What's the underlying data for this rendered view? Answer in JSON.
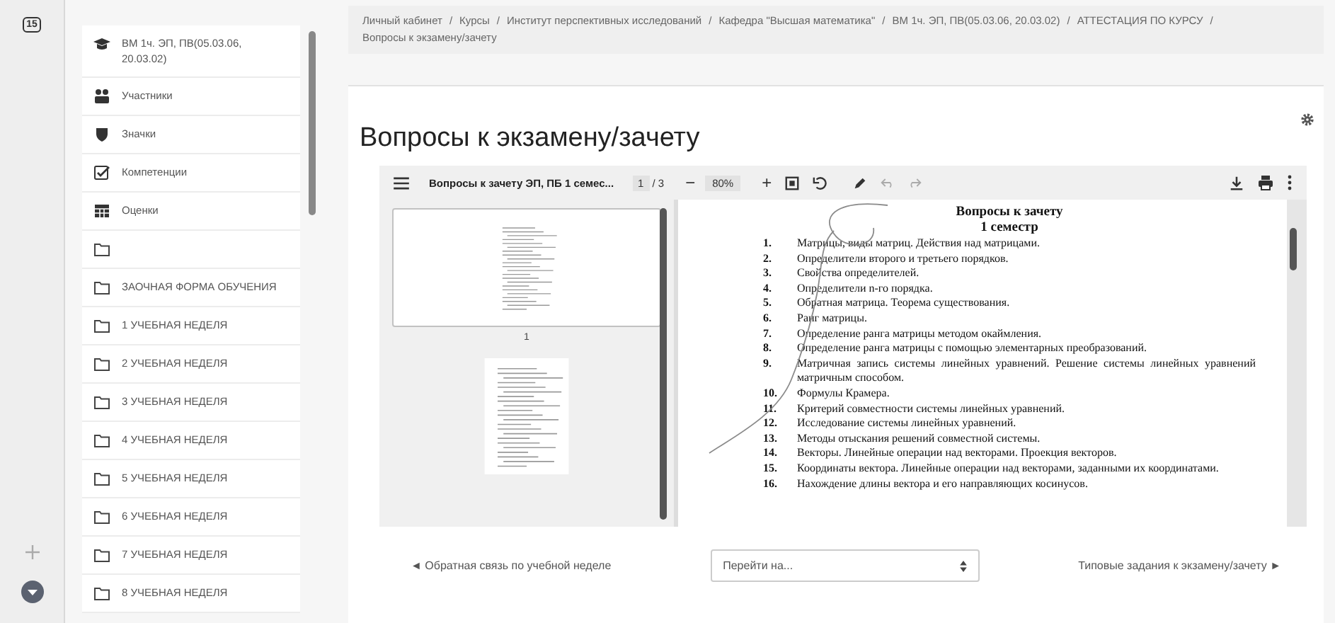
{
  "left_rail": {
    "calendar_badge": "15"
  },
  "nav": {
    "items": [
      {
        "kind": "cap",
        "label": "ВМ 1ч. ЭП, ПВ(05.03.06, 20.03.02)"
      },
      {
        "kind": "users",
        "label": "Участники"
      },
      {
        "kind": "shield",
        "label": "Значки"
      },
      {
        "kind": "check",
        "label": "Компетенции"
      },
      {
        "kind": "table",
        "label": "Оценки"
      },
      {
        "kind": "folder"
      },
      {
        "kind": "folder",
        "label": "ЗАОЧНАЯ ФОРМА ОБУЧЕНИЯ"
      },
      {
        "kind": "folder",
        "label": "1 УЧЕБНАЯ НЕДЕЛЯ"
      },
      {
        "kind": "folder",
        "label": "2 УЧЕБНАЯ НЕДЕЛЯ"
      },
      {
        "kind": "folder",
        "label": "3 УЧЕБНАЯ НЕДЕЛЯ"
      },
      {
        "kind": "folder",
        "label": "4 УЧЕБНАЯ НЕДЕЛЯ"
      },
      {
        "kind": "folder",
        "label": "5 УЧЕБНАЯ НЕДЕЛЯ"
      },
      {
        "kind": "folder",
        "label": "6 УЧЕБНАЯ НЕДЕЛЯ"
      },
      {
        "kind": "folder",
        "label": "7 УЧЕБНАЯ НЕДЕЛЯ"
      },
      {
        "kind": "folder",
        "label": "8 УЧЕБНАЯ НЕДЕЛЯ"
      }
    ]
  },
  "breadcrumb": {
    "separator": "/",
    "items": [
      "Личный кабинет",
      "Курсы",
      "Институт перспективных исследований",
      "Кафедра \"Высшая математика\"",
      "ВМ 1ч. ЭП, ПВ(05.03.06, 20.03.02)",
      "АТТЕСТАЦИЯ ПО КУРСУ",
      "Вопросы к экзамену/зачету"
    ]
  },
  "page_title": "Вопросы к экзамену/зачету",
  "pdf_viewer": {
    "toolbar": {
      "title": "Вопросы к зачету ЭП, ПБ 1 семес...",
      "page": "1",
      "page_total": "/ 3",
      "zoom_out": "−",
      "zoom": "80%",
      "zoom_in": "+"
    },
    "thumbnails": [
      {
        "label": "1",
        "selected": true
      },
      {
        "selected": false
      }
    ],
    "document": {
      "title": "Вопросы к зачету",
      "subtitle": "1 семестр",
      "items": [
        {
          "num": "1.",
          "text": "Матрицы, виды матриц. Действия над матрицами."
        },
        {
          "num": "2.",
          "text": "Определители второго и третьего порядков."
        },
        {
          "num": "3.",
          "text": "Свойства определителей."
        },
        {
          "num": "4.",
          "text": "Определители n-го порядка."
        },
        {
          "num": "5.",
          "text": "Обратная матрица. Теорема существования."
        },
        {
          "num": "6.",
          "text": "Ранг матрицы."
        },
        {
          "num": "7.",
          "text": "Определение ранга матрицы методом окаймления."
        },
        {
          "num": "8.",
          "text": "Определение ранга матрицы с помощью элементарных преобразований."
        },
        {
          "num": "9.",
          "text": "Матричная запись системы линейных уравнений. Решение системы линейных уравнений матричным способом."
        },
        {
          "num": "10.",
          "text": "Формулы Крамера."
        },
        {
          "num": "11.",
          "text": "Критерий совместности системы линейных уравнений."
        },
        {
          "num": "12.",
          "text": "Исследование системы линейных уравнений."
        },
        {
          "num": "13.",
          "text": "Методы отыскания решений совместной системы."
        },
        {
          "num": "14.",
          "text": "Векторы. Линейные операции над векторами. Проекция векторов."
        },
        {
          "num": "15.",
          "text": "Координаты вектора. Линейные операции над векторами, заданными их координатами."
        },
        {
          "num": "16.",
          "text": "Нахождение длины вектора и его направляющих косинусов."
        }
      ]
    }
  },
  "footer": {
    "prev": "◄ Обратная связь по учебной неделе",
    "jump_placeholder": "Перейти на...",
    "next": "Типовые задания к экзамену/зачету ►"
  }
}
